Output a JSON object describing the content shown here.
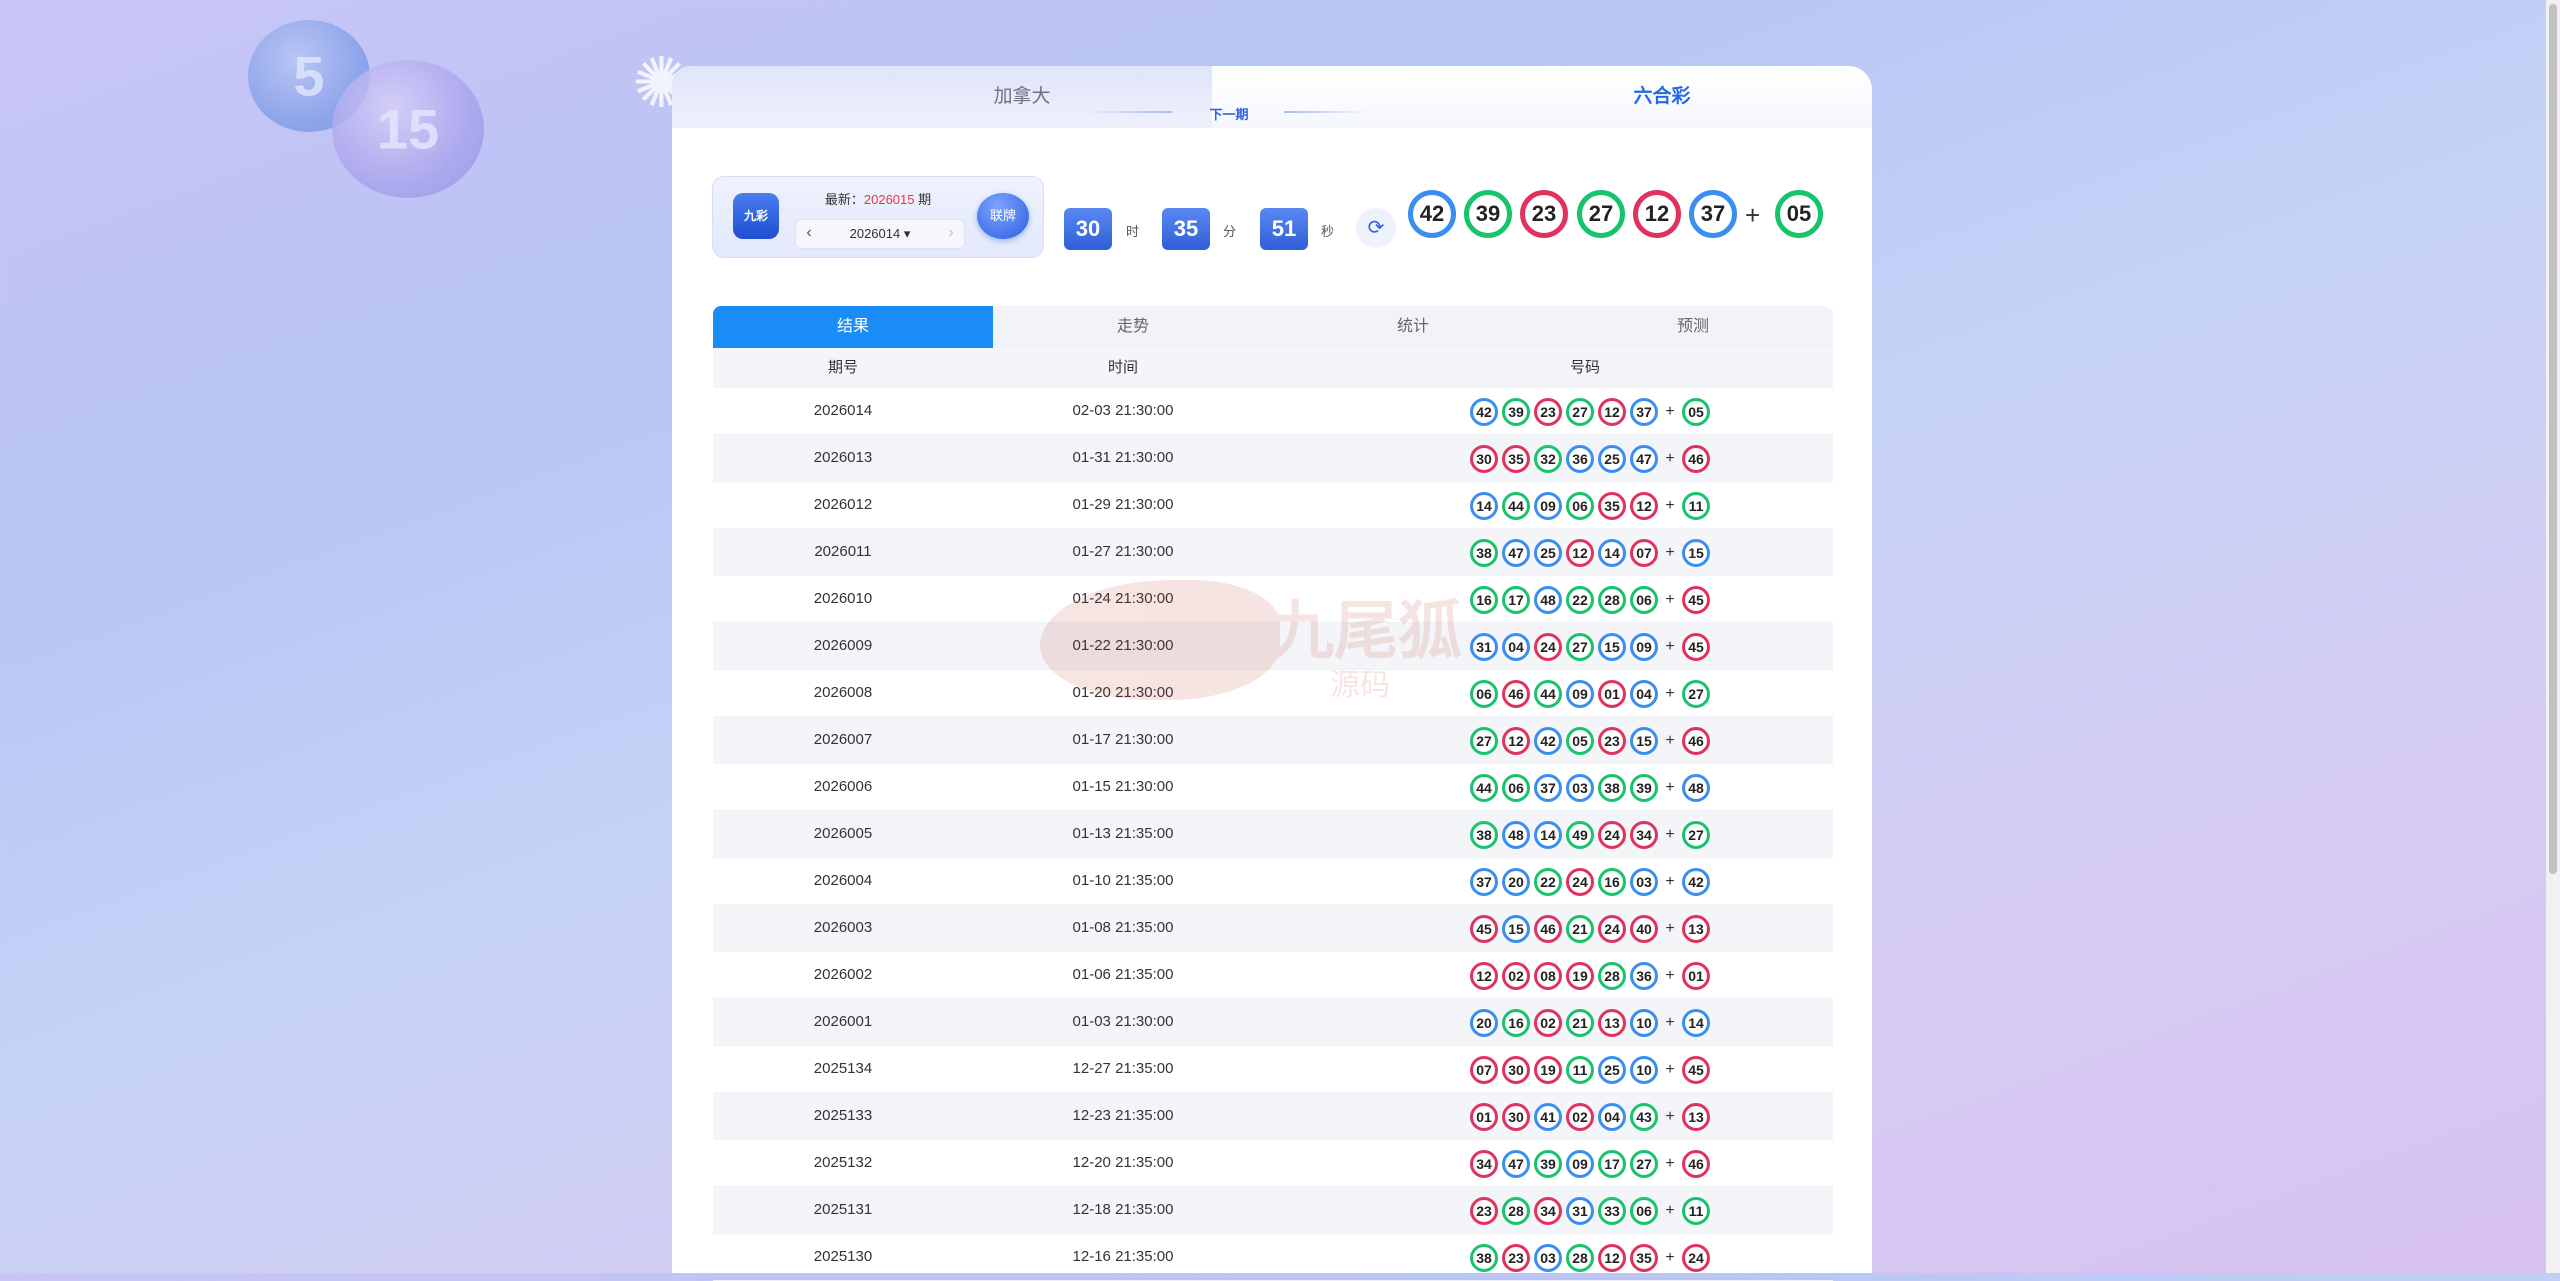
{
  "tabs": {
    "left": "加拿大",
    "right": "六合彩"
  },
  "info": {
    "logo_text": "九彩",
    "latest_label": "最新：",
    "latest_period": "2026015",
    "latest_suffix": "期",
    "selected_period": "2026014",
    "live_label": "联牌"
  },
  "countdown": {
    "title": "下一期",
    "hours": "30",
    "hours_unit": "时",
    "minutes": "35",
    "minutes_unit": "分",
    "seconds": "51",
    "seconds_unit": "秒"
  },
  "latest_result": {
    "balls": [
      {
        "num": "42",
        "color": "blue"
      },
      {
        "num": "39",
        "color": "green"
      },
      {
        "num": "23",
        "color": "red"
      },
      {
        "num": "27",
        "color": "green"
      },
      {
        "num": "12",
        "color": "red"
      },
      {
        "num": "37",
        "color": "blue"
      }
    ],
    "plus": "+",
    "special": {
      "num": "05",
      "color": "green"
    }
  },
  "table_tabs": [
    "结果",
    "走势",
    "统计",
    "预测"
  ],
  "table_headers": {
    "period": "期号",
    "time": "时间",
    "numbers": "号码"
  },
  "rows": [
    {
      "period": "2026014",
      "time": "02-03 21:30:00",
      "balls": [
        [
          "42",
          "blue"
        ],
        [
          "39",
          "green"
        ],
        [
          "23",
          "red"
        ],
        [
          "27",
          "green"
        ],
        [
          "12",
          "red"
        ],
        [
          "37",
          "blue"
        ]
      ],
      "special": [
        "05",
        "green"
      ]
    },
    {
      "period": "2026013",
      "time": "01-31 21:30:00",
      "balls": [
        [
          "30",
          "red"
        ],
        [
          "35",
          "red"
        ],
        [
          "32",
          "green"
        ],
        [
          "36",
          "blue"
        ],
        [
          "25",
          "blue"
        ],
        [
          "47",
          "blue"
        ]
      ],
      "special": [
        "46",
        "red"
      ]
    },
    {
      "period": "2026012",
      "time": "01-29 21:30:00",
      "balls": [
        [
          "14",
          "blue"
        ],
        [
          "44",
          "green"
        ],
        [
          "09",
          "blue"
        ],
        [
          "06",
          "green"
        ],
        [
          "35",
          "red"
        ],
        [
          "12",
          "red"
        ]
      ],
      "special": [
        "11",
        "green"
      ]
    },
    {
      "period": "2026011",
      "time": "01-27 21:30:00",
      "balls": [
        [
          "38",
          "green"
        ],
        [
          "47",
          "blue"
        ],
        [
          "25",
          "blue"
        ],
        [
          "12",
          "red"
        ],
        [
          "14",
          "blue"
        ],
        [
          "07",
          "red"
        ]
      ],
      "special": [
        "15",
        "blue"
      ]
    },
    {
      "period": "2026010",
      "time": "01-24 21:30:00",
      "balls": [
        [
          "16",
          "green"
        ],
        [
          "17",
          "green"
        ],
        [
          "48",
          "blue"
        ],
        [
          "22",
          "green"
        ],
        [
          "28",
          "green"
        ],
        [
          "06",
          "green"
        ]
      ],
      "special": [
        "45",
        "red"
      ]
    },
    {
      "period": "2026009",
      "time": "01-22 21:30:00",
      "balls": [
        [
          "31",
          "blue"
        ],
        [
          "04",
          "blue"
        ],
        [
          "24",
          "red"
        ],
        [
          "27",
          "green"
        ],
        [
          "15",
          "blue"
        ],
        [
          "09",
          "blue"
        ]
      ],
      "special": [
        "45",
        "red"
      ]
    },
    {
      "period": "2026008",
      "time": "01-20 21:30:00",
      "balls": [
        [
          "06",
          "green"
        ],
        [
          "46",
          "red"
        ],
        [
          "44",
          "green"
        ],
        [
          "09",
          "blue"
        ],
        [
          "01",
          "red"
        ],
        [
          "04",
          "blue"
        ]
      ],
      "special": [
        "27",
        "green"
      ]
    },
    {
      "period": "2026007",
      "time": "01-17 21:30:00",
      "balls": [
        [
          "27",
          "green"
        ],
        [
          "12",
          "red"
        ],
        [
          "42",
          "blue"
        ],
        [
          "05",
          "green"
        ],
        [
          "23",
          "red"
        ],
        [
          "15",
          "blue"
        ]
      ],
      "special": [
        "46",
        "red"
      ]
    },
    {
      "period": "2026006",
      "time": "01-15 21:30:00",
      "balls": [
        [
          "44",
          "green"
        ],
        [
          "06",
          "green"
        ],
        [
          "37",
          "blue"
        ],
        [
          "03",
          "blue"
        ],
        [
          "38",
          "green"
        ],
        [
          "39",
          "green"
        ]
      ],
      "special": [
        "48",
        "blue"
      ]
    },
    {
      "period": "2026005",
      "time": "01-13 21:35:00",
      "balls": [
        [
          "38",
          "green"
        ],
        [
          "48",
          "blue"
        ],
        [
          "14",
          "blue"
        ],
        [
          "49",
          "green"
        ],
        [
          "24",
          "red"
        ],
        [
          "34",
          "red"
        ]
      ],
      "special": [
        "27",
        "green"
      ]
    },
    {
      "period": "2026004",
      "time": "01-10 21:35:00",
      "balls": [
        [
          "37",
          "blue"
        ],
        [
          "20",
          "blue"
        ],
        [
          "22",
          "green"
        ],
        [
          "24",
          "red"
        ],
        [
          "16",
          "green"
        ],
        [
          "03",
          "blue"
        ]
      ],
      "special": [
        "42",
        "blue"
      ]
    },
    {
      "period": "2026003",
      "time": "01-08 21:35:00",
      "balls": [
        [
          "45",
          "red"
        ],
        [
          "15",
          "blue"
        ],
        [
          "46",
          "red"
        ],
        [
          "21",
          "green"
        ],
        [
          "24",
          "red"
        ],
        [
          "40",
          "red"
        ]
      ],
      "special": [
        "13",
        "red"
      ]
    },
    {
      "period": "2026002",
      "time": "01-06 21:35:00",
      "balls": [
        [
          "12",
          "red"
        ],
        [
          "02",
          "red"
        ],
        [
          "08",
          "red"
        ],
        [
          "19",
          "red"
        ],
        [
          "28",
          "green"
        ],
        [
          "36",
          "blue"
        ]
      ],
      "special": [
        "01",
        "red"
      ]
    },
    {
      "period": "2026001",
      "time": "01-03 21:30:00",
      "balls": [
        [
          "20",
          "blue"
        ],
        [
          "16",
          "green"
        ],
        [
          "02",
          "red"
        ],
        [
          "21",
          "green"
        ],
        [
          "13",
          "red"
        ],
        [
          "10",
          "blue"
        ]
      ],
      "special": [
        "14",
        "blue"
      ]
    },
    {
      "period": "2025134",
      "time": "12-27 21:35:00",
      "balls": [
        [
          "07",
          "red"
        ],
        [
          "30",
          "red"
        ],
        [
          "19",
          "red"
        ],
        [
          "11",
          "green"
        ],
        [
          "25",
          "blue"
        ],
        [
          "10",
          "blue"
        ]
      ],
      "special": [
        "45",
        "red"
      ]
    },
    {
      "period": "2025133",
      "time": "12-23 21:35:00",
      "balls": [
        [
          "01",
          "red"
        ],
        [
          "30",
          "red"
        ],
        [
          "41",
          "blue"
        ],
        [
          "02",
          "red"
        ],
        [
          "04",
          "blue"
        ],
        [
          "43",
          "green"
        ]
      ],
      "special": [
        "13",
        "red"
      ]
    },
    {
      "period": "2025132",
      "time": "12-20 21:35:00",
      "balls": [
        [
          "34",
          "red"
        ],
        [
          "47",
          "blue"
        ],
        [
          "39",
          "green"
        ],
        [
          "09",
          "blue"
        ],
        [
          "17",
          "green"
        ],
        [
          "27",
          "green"
        ]
      ],
      "special": [
        "46",
        "red"
      ]
    },
    {
      "period": "2025131",
      "time": "12-18 21:35:00",
      "balls": [
        [
          "23",
          "red"
        ],
        [
          "28",
          "green"
        ],
        [
          "34",
          "red"
        ],
        [
          "31",
          "blue"
        ],
        [
          "33",
          "green"
        ],
        [
          "06",
          "green"
        ]
      ],
      "special": [
        "11",
        "green"
      ]
    },
    {
      "period": "2025130",
      "time": "12-16 21:35:00",
      "balls": [
        [
          "38",
          "green"
        ],
        [
          "23",
          "red"
        ],
        [
          "03",
          "blue"
        ],
        [
          "28",
          "green"
        ],
        [
          "12",
          "red"
        ],
        [
          "35",
          "red"
        ]
      ],
      "special": [
        "24",
        "red"
      ]
    }
  ]
}
